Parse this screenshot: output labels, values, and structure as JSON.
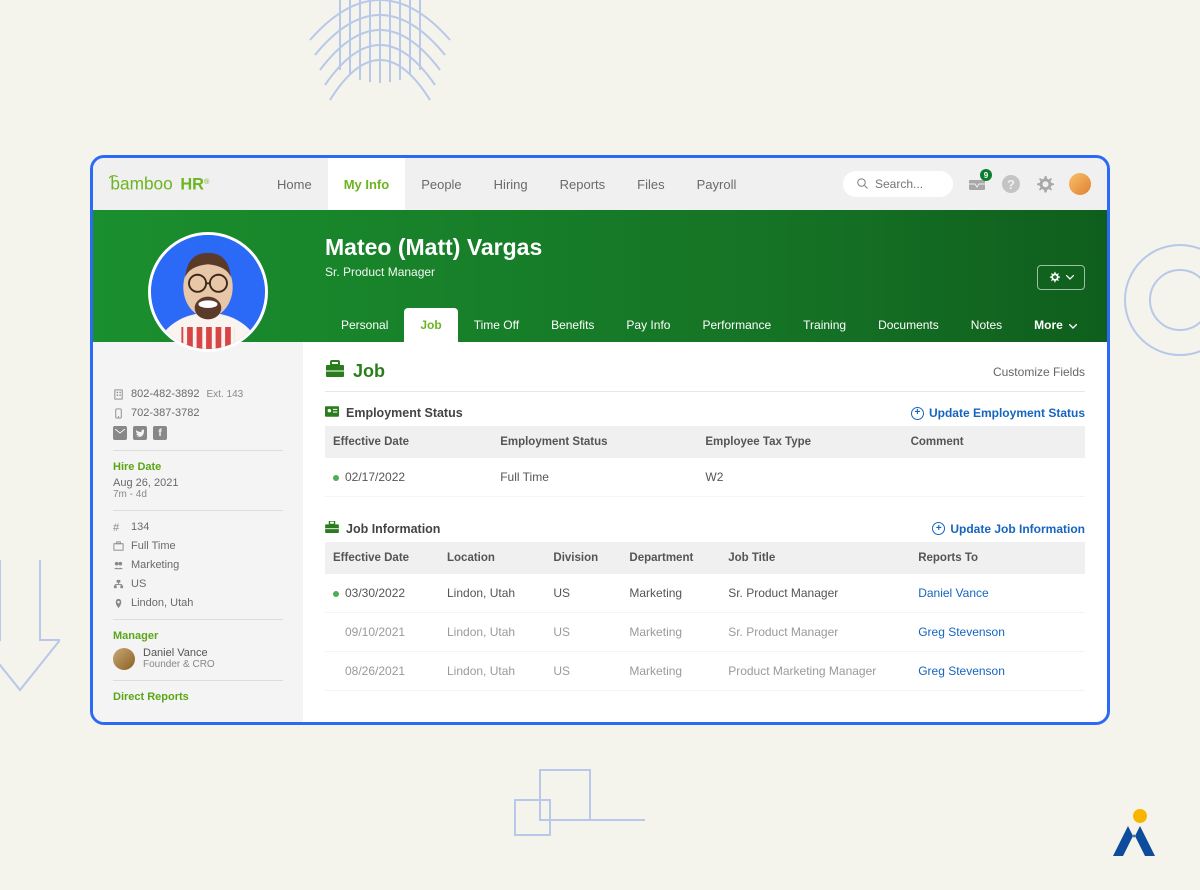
{
  "brand": "bambooHR",
  "nav": {
    "items": [
      "Home",
      "My Info",
      "People",
      "Hiring",
      "Reports",
      "Files",
      "Payroll"
    ],
    "active_index": 1
  },
  "search_placeholder": "Search...",
  "notification_count": "9",
  "colors": {
    "brand_green": "#6cb421",
    "header_green_start": "#1a8f2e",
    "header_green_end": "#0f5e1d",
    "frame_blue": "#2b69f7",
    "link_blue": "#1565c0"
  },
  "employee": {
    "name": "Mateo (Matt) Vargas",
    "title": "Sr. Product Manager"
  },
  "subtabs": {
    "items": [
      "Personal",
      "Job",
      "Time Off",
      "Benefits",
      "Pay Info",
      "Performance",
      "Training",
      "Documents",
      "Notes"
    ],
    "more_label": "More",
    "active_index": 1
  },
  "sidebar": {
    "phone": "802-482-3892",
    "phone_ext": "Ext. 143",
    "mobile": "702-387-3782",
    "hire_date_label": "Hire Date",
    "hire_date": "Aug 26, 2021",
    "tenure": "7m - 4d",
    "emp_number": "134",
    "employment_type": "Full Time",
    "department": "Marketing",
    "country": "US",
    "location": "Lindon, Utah",
    "manager_label": "Manager",
    "manager_name": "Daniel Vance",
    "manager_title": "Founder & CRO",
    "direct_reports_label": "Direct Reports"
  },
  "page": {
    "title": "Job",
    "customize_label": "Customize Fields"
  },
  "employment_status": {
    "section_label": "Employment Status",
    "update_label": "Update Employment Status",
    "headers": [
      "Effective Date",
      "Employment Status",
      "Employee Tax Type",
      "Comment"
    ],
    "rows": [
      {
        "active": true,
        "date": "02/17/2022",
        "status": "Full Time",
        "tax_type": "W2",
        "comment": ""
      }
    ]
  },
  "job_info": {
    "section_label": "Job Information",
    "update_label": "Update Job Information",
    "headers": [
      "Effective Date",
      "Location",
      "Division",
      "Department",
      "Job Title",
      "Reports To"
    ],
    "rows": [
      {
        "active": true,
        "date": "03/30/2022",
        "location": "Lindon, Utah",
        "division": "US",
        "department": "Marketing",
        "title": "Sr. Product Manager",
        "reports_to": "Daniel Vance"
      },
      {
        "active": false,
        "date": "09/10/2021",
        "location": "Lindon, Utah",
        "division": "US",
        "department": "Marketing",
        "title": "Sr. Product Manager",
        "reports_to": "Greg Stevenson"
      },
      {
        "active": false,
        "date": "08/26/2021",
        "location": "Lindon, Utah",
        "division": "US",
        "department": "Marketing",
        "title": "Product Marketing Manager",
        "reports_to": "Greg Stevenson"
      }
    ]
  }
}
